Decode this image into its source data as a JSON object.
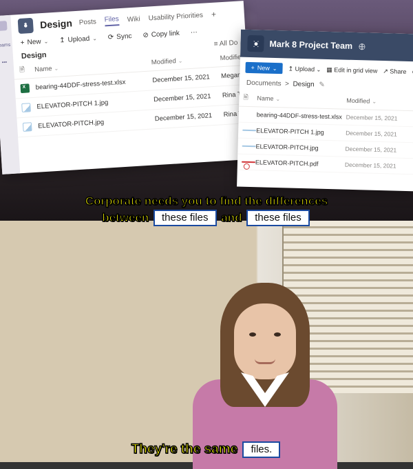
{
  "teams": {
    "rail_label": "Teams",
    "channel": "Design",
    "tabs": [
      "Posts",
      "Files",
      "Wiki",
      "Usability Priorities"
    ],
    "active_tab": "Files",
    "cmd": {
      "new": "New",
      "upload": "Upload",
      "sync": "Sync",
      "copylink": "Copy link",
      "more": "···"
    },
    "section_title": "Design",
    "view_toggle": "All Do",
    "cols": {
      "name": "Name",
      "modified": "Modified",
      "modifiedby": "Modified b"
    },
    "files": [
      {
        "name": "bearing-44DDF-stress-test.xlsx",
        "type": "xlsx",
        "modified": "December 15, 2021",
        "by": "Megan B"
      },
      {
        "name": "ELEVATOR-PITCH 1.jpg",
        "type": "jpg",
        "modified": "December 15, 2021",
        "by": "Rina Tapa"
      },
      {
        "name": "ELEVATOR-PITCH.jpg",
        "type": "jpg",
        "modified": "December 15, 2021",
        "by": "Rina Tapa"
      }
    ]
  },
  "sharepoint": {
    "site": "Mark 8 Project Team",
    "cmd": {
      "new": "New",
      "upload": "Upload",
      "grid": "Edit in grid view",
      "share": "Share",
      "copy": "C"
    },
    "breadcrumb": {
      "root": "Documents",
      "current": "Design"
    },
    "cols": {
      "name": "Name",
      "modified": "Modified"
    },
    "files": [
      {
        "name": "bearing-44DDF-stress-test.xlsx",
        "type": "xlsx",
        "modified": "December 15, 2021"
      },
      {
        "name": "ELEVATOR-PITCH 1.jpg",
        "type": "jpg",
        "modified": "December 15, 2021"
      },
      {
        "name": "ELEVATOR-PITCH.jpg",
        "type": "jpg",
        "modified": "December 15, 2021"
      },
      {
        "name": "ELEVATOR-PITCH.pdf",
        "type": "pdf",
        "modified": "December 15, 2021"
      }
    ]
  },
  "meme": {
    "line1": "Corporate needs you to find the differences",
    "line2a": "between",
    "chip1": "these files",
    "line2b": "and",
    "chip2": "these files",
    "bottom_a": "They're the same",
    "bottom_chip": "files."
  }
}
